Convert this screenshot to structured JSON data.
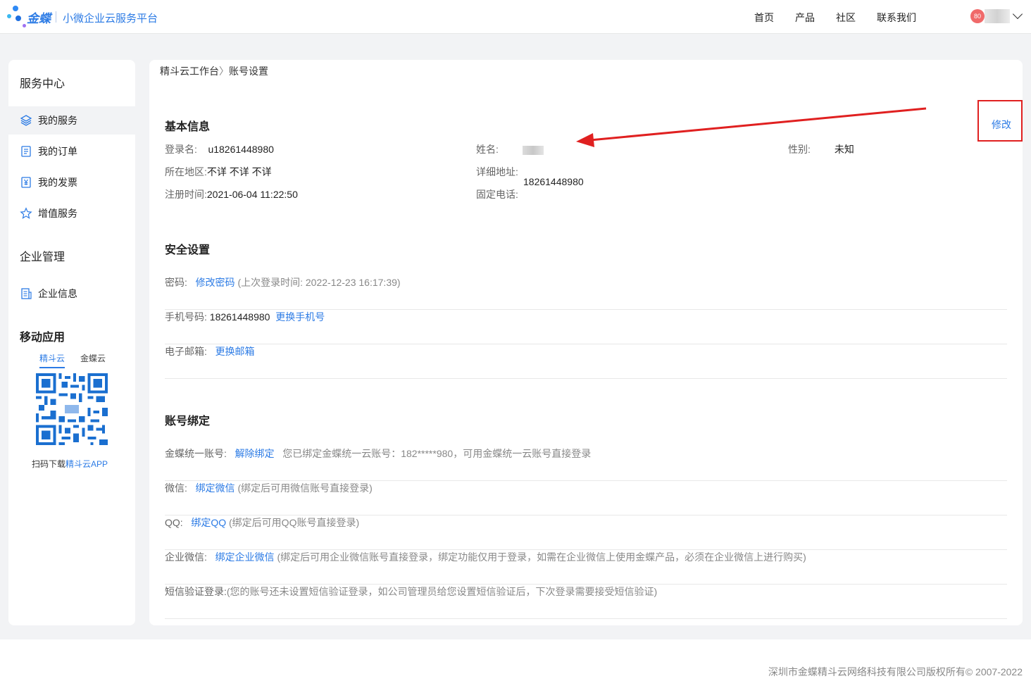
{
  "header": {
    "brand": "金蝶",
    "subtitle": "小微企业云服务平台",
    "nav": [
      "首页",
      "产品",
      "社区",
      "联系我们"
    ],
    "avatar_badge": "80"
  },
  "sidebar": {
    "group1": "服务中心",
    "items": [
      "我的服务",
      "我的订单",
      "我的发票",
      "增值服务"
    ],
    "group2": "企业管理",
    "items2": [
      "企业信息"
    ],
    "mobile_title": "移动应用",
    "mobile_tabs": [
      "精斗云",
      "金蝶云"
    ],
    "qr_caption_prefix": "扫码下载",
    "qr_caption_highlight": "精斗云APP"
  },
  "breadcrumb": {
    "root": "精斗云工作台",
    "sep": "〉",
    "current": "账号设置"
  },
  "basic": {
    "title": "基本信息",
    "edit": "修改",
    "login_label": "登录名:",
    "login_value": "u18261448980",
    "name_label": "姓名:",
    "gender_label": "性别:",
    "gender_value": "未知",
    "region_label": "所在地区:",
    "region_value": "不详 不详 不详",
    "address_label": "详细地址:",
    "address_value": "18261448980",
    "reg_label": "注册时间:",
    "reg_value": "2021-06-04 11:22:50",
    "phone_label": "固定电话:"
  },
  "security": {
    "title": "安全设置",
    "password_label": "密码:",
    "password_link": "修改密码",
    "password_note": "(上次登录时间: 2022-12-23 16:17:39)",
    "mobile_label": "手机号码:",
    "mobile_value": "18261448980",
    "mobile_link": "更换手机号",
    "email_label": "电子邮箱:",
    "email_link": "更换邮箱"
  },
  "binding": {
    "title": "账号绑定",
    "kingdee_label": "金蝶统一账号:",
    "kingdee_link": "解除绑定",
    "kingdee_note": "您已绑定金蝶统一云账号：182*****980，可用金蝶统一云账号直接登录",
    "wechat_label": "微信:",
    "wechat_link": "绑定微信",
    "wechat_note": "(绑定后可用微信账号直接登录)",
    "qq_label": "QQ:",
    "qq_link": "绑定QQ",
    "qq_note": "(绑定后可用QQ账号直接登录)",
    "wework_label": "企业微信:",
    "wework_link": "绑定企业微信",
    "wework_note": "(绑定后可用企业微信账号直接登录，绑定功能仅用于登录，如需在企业微信上使用金蝶产品，必须在企业微信上进行购买)",
    "sms_label": "短信验证登录:",
    "sms_note": "(您的账号还未设置短信验证登录，如公司管理员给您设置短信验证后，下次登录需要接受短信验证)"
  },
  "footer": {
    "copyright": "深圳市金蝶精斗云网络科技有限公司版权所有© 2007-2022"
  },
  "colors": {
    "accent": "#2c7be5",
    "annotation": "#e02020"
  }
}
